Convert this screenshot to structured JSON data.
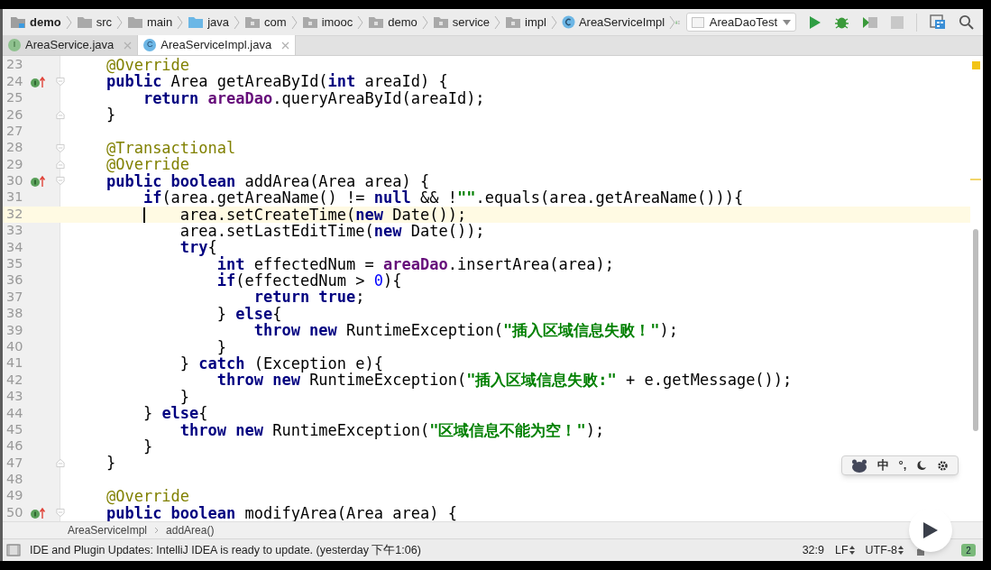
{
  "navigation_bar": {
    "breadcrumbs": [
      {
        "kind": "module",
        "label": "demo"
      },
      {
        "kind": "folder",
        "label": "src"
      },
      {
        "kind": "folder",
        "label": "main"
      },
      {
        "kind": "source",
        "label": "java"
      },
      {
        "kind": "package",
        "label": "com"
      },
      {
        "kind": "package",
        "label": "imooc"
      },
      {
        "kind": "package",
        "label": "demo"
      },
      {
        "kind": "package",
        "label": "service"
      },
      {
        "kind": "package",
        "label": "impl"
      },
      {
        "kind": "class",
        "label": "AreaServiceImpl"
      }
    ],
    "run_config": "AreaDaoTest",
    "stop_disabled": true
  },
  "tabs": [
    {
      "kind": "interface",
      "badge": "I",
      "label": "AreaService.java",
      "selected": false
    },
    {
      "kind": "class",
      "badge": "C",
      "label": "AreaServiceImpl.java",
      "selected": true
    }
  ],
  "editor": {
    "lines": [
      {
        "n": "23",
        "current": false,
        "segments": [
          {
            "kind": "annotation",
            "text": "    @Override"
          }
        ]
      },
      {
        "n": "24",
        "current": false,
        "marker": {
          "kind": "implements"
        },
        "fold": {
          "kind": "start"
        },
        "segments": [
          {
            "kind": "keyword",
            "text": "    public"
          },
          {
            "kind": "plain",
            "text": " Area getAreaById("
          },
          {
            "kind": "keyword",
            "text": "int"
          },
          {
            "kind": "plain",
            "text": " areaId) {"
          }
        ]
      },
      {
        "n": "25",
        "current": false,
        "segments": [
          {
            "kind": "keyword",
            "text": "        return "
          },
          {
            "kind": "field",
            "text": "areaDao"
          },
          {
            "kind": "plain",
            "text": ".queryAreaById(areaId);"
          }
        ]
      },
      {
        "n": "26",
        "current": false,
        "fold": {
          "kind": "end"
        },
        "segments": [
          {
            "kind": "plain",
            "text": "    }"
          }
        ]
      },
      {
        "n": "27",
        "current": false
      },
      {
        "n": "28",
        "current": false,
        "fold": {
          "kind": "start"
        },
        "segments": [
          {
            "kind": "annotation",
            "text": "    @Transactional"
          }
        ]
      },
      {
        "n": "29",
        "current": false,
        "fold": {
          "kind": "end"
        },
        "segments": [
          {
            "kind": "annotation",
            "text": "    @Override"
          }
        ]
      },
      {
        "n": "30",
        "current": false,
        "marker": {
          "kind": "implements"
        },
        "fold": {
          "kind": "start"
        },
        "segments": [
          {
            "kind": "keyword",
            "text": "    public boolean"
          },
          {
            "kind": "plain",
            "text": " addArea(Area area) {"
          }
        ]
      },
      {
        "n": "31",
        "current": false,
        "segments": [
          {
            "kind": "keyword",
            "text": "        if"
          },
          {
            "kind": "plain",
            "text": "(area.getAreaName() != "
          },
          {
            "kind": "keyword",
            "text": "null"
          },
          {
            "kind": "plain",
            "text": " && !"
          },
          {
            "kind": "string",
            "text": "\"\""
          },
          {
            "kind": "plain",
            "text": ".equals(area.getAreaName())){"
          }
        ]
      },
      {
        "n": "32",
        "current": true,
        "segments": [
          {
            "kind": "plain",
            "text": "            area.setCreateTime("
          },
          {
            "kind": "keyword",
            "text": "new"
          },
          {
            "kind": "plain",
            "text": " Date());"
          }
        ]
      },
      {
        "n": "33",
        "current": false,
        "segments": [
          {
            "kind": "plain",
            "text": "            area.setLastEditTime("
          },
          {
            "kind": "keyword",
            "text": "new"
          },
          {
            "kind": "plain",
            "text": " Date());"
          }
        ]
      },
      {
        "n": "34",
        "current": false,
        "segments": [
          {
            "kind": "keyword",
            "text": "            try"
          },
          {
            "kind": "plain",
            "text": "{"
          }
        ]
      },
      {
        "n": "35",
        "current": false,
        "segments": [
          {
            "kind": "keyword",
            "text": "                int"
          },
          {
            "kind": "plain",
            "text": " effectedNum = "
          },
          {
            "kind": "field",
            "text": "areaDao"
          },
          {
            "kind": "plain",
            "text": ".insertArea(area);"
          }
        ]
      },
      {
        "n": "36",
        "current": false,
        "segments": [
          {
            "kind": "keyword",
            "text": "                if"
          },
          {
            "kind": "plain",
            "text": "(effectedNum > "
          },
          {
            "kind": "number",
            "text": "0"
          },
          {
            "kind": "plain",
            "text": "){"
          }
        ]
      },
      {
        "n": "37",
        "current": false,
        "segments": [
          {
            "kind": "keyword",
            "text": "                    return true"
          },
          {
            "kind": "plain",
            "text": ";"
          }
        ]
      },
      {
        "n": "38",
        "current": false,
        "segments": [
          {
            "kind": "plain",
            "text": "                } "
          },
          {
            "kind": "keyword",
            "text": "else"
          },
          {
            "kind": "plain",
            "text": "{"
          }
        ]
      },
      {
        "n": "39",
        "current": false,
        "segments": [
          {
            "kind": "keyword",
            "text": "                    throw new"
          },
          {
            "kind": "plain",
            "text": " RuntimeException("
          },
          {
            "kind": "string",
            "text": "\"插入区域信息失败！\""
          },
          {
            "kind": "plain",
            "text": ");"
          }
        ]
      },
      {
        "n": "40",
        "current": false,
        "segments": [
          {
            "kind": "plain",
            "text": "                }"
          }
        ]
      },
      {
        "n": "41",
        "current": false,
        "segments": [
          {
            "kind": "plain",
            "text": "            } "
          },
          {
            "kind": "keyword",
            "text": "catch"
          },
          {
            "kind": "plain",
            "text": " (Exception e){"
          }
        ]
      },
      {
        "n": "42",
        "current": false,
        "segments": [
          {
            "kind": "keyword",
            "text": "                throw new"
          },
          {
            "kind": "plain",
            "text": " RuntimeException("
          },
          {
            "kind": "string",
            "text": "\"插入区域信息失败:\""
          },
          {
            "kind": "plain",
            "text": " + e.getMessage());"
          }
        ]
      },
      {
        "n": "43",
        "current": false,
        "segments": [
          {
            "kind": "plain",
            "text": "            }"
          }
        ]
      },
      {
        "n": "44",
        "current": false,
        "segments": [
          {
            "kind": "plain",
            "text": "        } "
          },
          {
            "kind": "keyword",
            "text": "else"
          },
          {
            "kind": "plain",
            "text": "{"
          }
        ]
      },
      {
        "n": "45",
        "current": false,
        "segments": [
          {
            "kind": "keyword",
            "text": "            throw new"
          },
          {
            "kind": "plain",
            "text": " RuntimeException("
          },
          {
            "kind": "string",
            "text": "\"区域信息不能为空！\""
          },
          {
            "kind": "plain",
            "text": ");"
          }
        ]
      },
      {
        "n": "46",
        "current": false,
        "segments": [
          {
            "kind": "plain",
            "text": "        }"
          }
        ]
      },
      {
        "n": "47",
        "current": false,
        "fold": {
          "kind": "end"
        },
        "segments": [
          {
            "kind": "plain",
            "text": "    }"
          }
        ]
      },
      {
        "n": "48",
        "current": false
      },
      {
        "n": "49",
        "current": false,
        "segments": [
          {
            "kind": "annotation",
            "text": "    @Override"
          }
        ]
      },
      {
        "n": "50",
        "current": false,
        "marker": {
          "kind": "implements"
        },
        "fold": {
          "kind": "start"
        },
        "segments": [
          {
            "kind": "keyword",
            "text": "    public boolean"
          },
          {
            "kind": "plain",
            "text": " modifyArea(Area area) {"
          }
        ]
      }
    ]
  },
  "ime_toolbar": {
    "mode": "中",
    "punctuation": "°,"
  },
  "code_breadcrumbs": [
    "AreaServiceImpl",
    "addArea()"
  ],
  "status_bar": {
    "message": "IDE and Plugin Updates: IntelliJ IDEA is ready to update. (yesterday 下午1:06)",
    "position": "32:9",
    "line_separator": "LF",
    "encoding": "UTF-8",
    "notifications": "2"
  }
}
